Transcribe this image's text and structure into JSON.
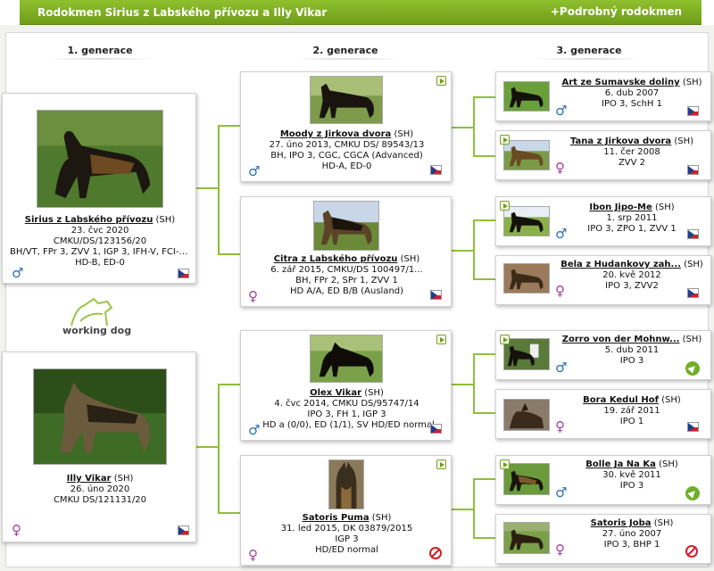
{
  "header": {
    "title": "Rodokmen Sirius z Labského přívozu a Illy Vikar",
    "detail_link": "+Podrobný rodokmen"
  },
  "generations": [
    "1. generace",
    "2. generace",
    "3. generace"
  ],
  "logo": {
    "text": "working dog"
  },
  "gen1": [
    {
      "name": "Sirius z Labského přívozu",
      "breed": "(SH)",
      "lines": [
        "23. čvc 2020",
        "CMKU/DS/123156/20",
        "BH/VT, FPr 3, ZVV 1, IGP 3, IFH-V, FCI-S...",
        "HD-B, ED-0"
      ],
      "sex": "♂"
    },
    {
      "name": "Illy Vikar",
      "breed": "(SH)",
      "lines": [
        "26. úno 2020",
        "CMKU DS/121131/20"
      ],
      "sex": "♀"
    }
  ],
  "gen2": [
    {
      "name": "Moody z Jirkova dvora",
      "breed": "(SH)",
      "lines": [
        "27. úno 2013, CMKU DS/ 89543/13",
        "BH, IPO 3, CGC, CGCA (Advanced)",
        "HD-A, ED-0"
      ],
      "sex": "♂"
    },
    {
      "name": "Citra z Labského přívozu",
      "breed": "(SH)",
      "lines": [
        "6. zář 2015, CMKU/DS 100497/1...",
        "BH, FPr 2, SPr 1, ZVV 1",
        "HD A/A, ED B/B (Ausland)"
      ],
      "sex": "♀"
    },
    {
      "name": "Olex Vikar",
      "breed": "(SH)",
      "lines": [
        "4. čvc 2014, CMKU DS/95747/14",
        "IPO 3, FH 1, IGP 3",
        "HD a (0/0), ED (1/1), SV HD/ED normal"
      ],
      "sex": "♂"
    },
    {
      "name": "Satoris Puma",
      "breed": "(SH)",
      "lines": [
        "31. led 2015, DK 03879/2015",
        "IGP 3",
        "HD/ED normal"
      ],
      "sex": "♀"
    }
  ],
  "gen3": [
    {
      "name": "Art ze Sumavske doliny",
      "breed": "(SH)",
      "lines": [
        "6. dub 2007",
        "IPO 3, SchH 1"
      ],
      "sex": "♂"
    },
    {
      "name": "Tana z Jirkova dvora",
      "breed": "(SH)",
      "lines": [
        "11. čer 2008",
        "ZVV 2"
      ],
      "sex": "♀"
    },
    {
      "name": "Ibon Jipo-Me",
      "breed": "(SH)",
      "lines": [
        "1. srp 2011",
        "IPO 3, ZPO 1, ZVV 1"
      ],
      "sex": "♂"
    },
    {
      "name": "Bela z Hudankovy zah...",
      "breed": "(SH)",
      "lines": [
        "20. kvě 2012",
        "IPO 3, ZVV2"
      ],
      "sex": "♀"
    },
    {
      "name": "Zorro von der Mohnw...",
      "breed": "(SH)",
      "lines": [
        "5. dub 2011",
        "IPO 3"
      ],
      "sex": "♂"
    },
    {
      "name": "Bora Kedul Hof",
      "breed": "(SH)",
      "lines": [
        "19. zář 2011",
        "IPO 1"
      ],
      "sex": "♀"
    },
    {
      "name": "Bolle Ja Na Ka",
      "breed": "(SH)",
      "lines": [
        "30. kvě 2011",
        "IPO 3"
      ],
      "sex": "♂"
    },
    {
      "name": "Satoris Joba",
      "breed": "(SH)",
      "lines": [
        "27. úno 2007",
        "IPO 3, BHP 1"
      ],
      "sex": "♀"
    }
  ],
  "colors": {
    "accent": "#6f9d1a",
    "male": "#2a6fb4",
    "female": "#a43b9e",
    "connector": "#8fbf3a"
  }
}
